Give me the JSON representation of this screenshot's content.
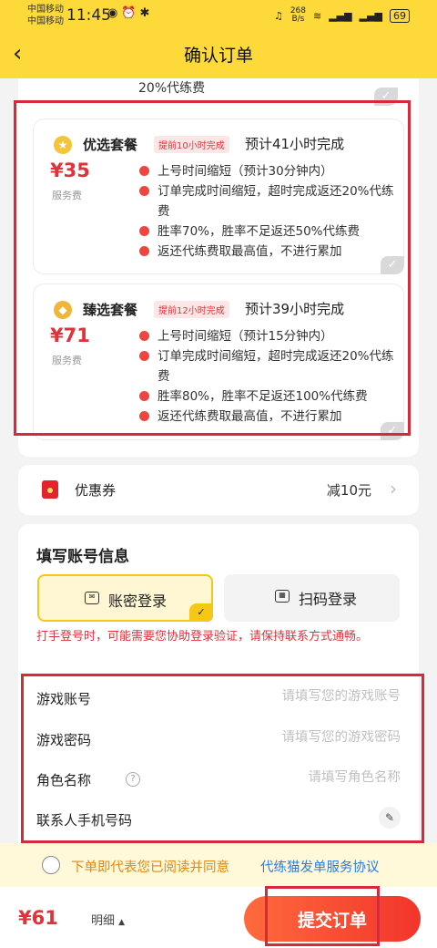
{
  "status_bar": {
    "carrier_1": "中国移动",
    "carrier_2": "中国移动",
    "time": "11:45",
    "net_speed": "268",
    "net_unit": "B/s",
    "battery": "69"
  },
  "header": {
    "title": "确认订单",
    "back_icon": "chevron-left-icon"
  },
  "prev_package": {
    "trailing_text": "20%代练费"
  },
  "packages": [
    {
      "name": "优选套餐",
      "badge": "提前10小时完成",
      "estimate": "预计41小时完成",
      "price": "¥35",
      "price_label": "服务费",
      "features": [
        "上号时间缩短（预计30分钟内）",
        "订单完成时间缩短，超时完成返还20%代练费",
        "胜率70%，胜率不足返还50%代练费",
        "返还代练费取最高值，不进行累加"
      ],
      "icon": "star-medal-icon",
      "icon_color": "#f4c43b"
    },
    {
      "name": "臻选套餐",
      "badge": "提前12小时完成",
      "estimate": "预计39小时完成",
      "price": "¥71",
      "price_label": "服务费",
      "features": [
        "上号时间缩短（预计15分钟内）",
        "订单完成时间缩短，超时完成返还20%代练费",
        "胜率80%，胜率不足返还100%代练费",
        "返还代练费取最高值，不进行累加"
      ],
      "icon": "diamond-medal-icon",
      "icon_color": "#f0b63a"
    }
  ],
  "coupon": {
    "label": "优惠券",
    "value": "减10元"
  },
  "account": {
    "title": "填写账号信息",
    "tab_password": "账密登录",
    "tab_qr": "扫码登录",
    "warning": "打手登号时，可能需要您协助登录验证，请保持联系方式通畅。",
    "fields": [
      {
        "label": "游戏账号",
        "placeholder": "请填写您的游戏账号"
      },
      {
        "label": "游戏密码",
        "placeholder": "请填写您的游戏密码"
      },
      {
        "label": "角色名称",
        "placeholder": "请填写角色名称"
      },
      {
        "label": "联系人手机号码",
        "placeholder": ""
      }
    ]
  },
  "agreement": {
    "text": "下单即代表您已阅读并同意",
    "link": "代练猫发单服务协议"
  },
  "footer": {
    "total": "¥61",
    "detail": "明细",
    "submit": "提交订单"
  },
  "colors": {
    "brand_yellow": "#fdd93a",
    "price_red": "#e0323a",
    "highlight_box": "#d6293a",
    "link_blue": "#2a7de1"
  }
}
